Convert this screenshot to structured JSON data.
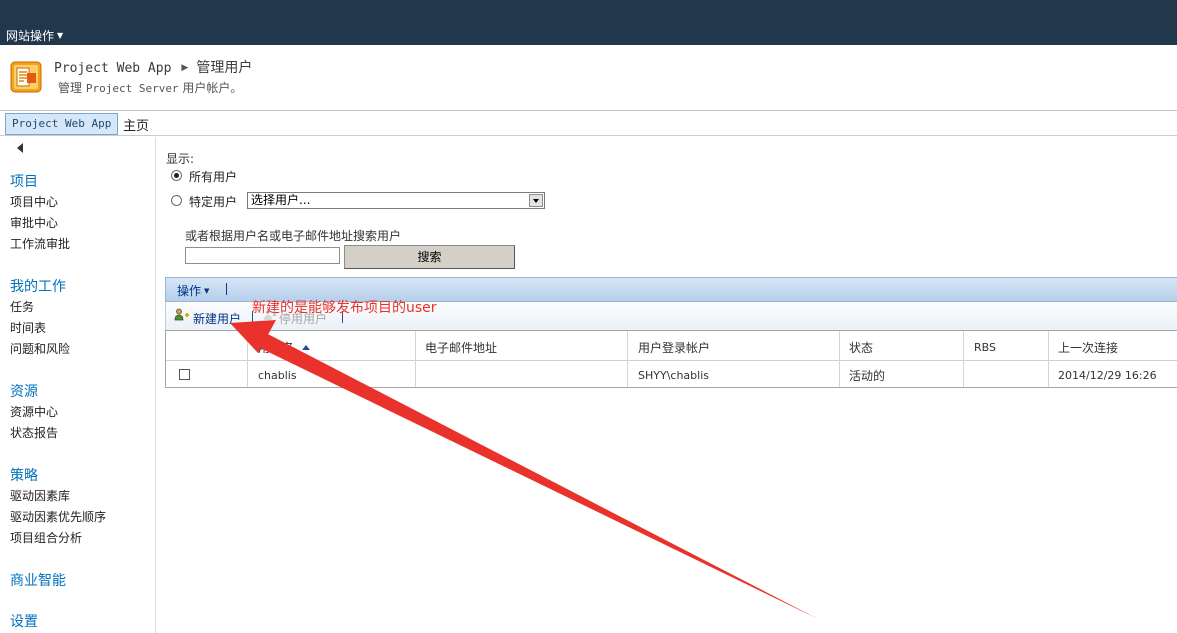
{
  "topbar": {
    "site_actions": "网站操作"
  },
  "title": {
    "app_link": "Project Web App",
    "current": "管理用户",
    "description_prefix": "管理",
    "description_mono": "Project Server",
    "description_suffix": "用户帐户。"
  },
  "topnav": {
    "active_tab": "Project Web App",
    "home": "主页"
  },
  "leftnav": {
    "groups": [
      {
        "heading": "项目",
        "items": [
          "项目中心",
          "审批中心",
          "工作流审批"
        ]
      },
      {
        "heading": "我的工作",
        "items": [
          "任务",
          "时间表",
          "问题和风险"
        ]
      },
      {
        "heading": "资源",
        "items": [
          "资源中心",
          "状态报告"
        ]
      },
      {
        "heading": "策略",
        "items": [
          "驱动因素库",
          "驱动因素优先顺序",
          "项目组合分析"
        ]
      },
      {
        "heading": "商业智能",
        "items": []
      },
      {
        "heading": "设置",
        "items": []
      }
    ]
  },
  "filter": {
    "show_label": "显示:",
    "all_users": "所有用户",
    "specific_users": "特定用户",
    "select_placeholder": "选择用户...",
    "search_hint": "或者根据用户名或电子邮件地址搜索用户",
    "search_button": "搜索"
  },
  "toolbar": {
    "actions_menu": "操作",
    "new_user": "新建用户",
    "disable_user": "停用用户"
  },
  "grid": {
    "headers": [
      "用户名",
      "电子邮件地址",
      "用户登录帐户",
      "状态",
      "RBS",
      "上一次连接"
    ],
    "rows": [
      {
        "name": "chablis",
        "email": "",
        "account": "SHYY\\chablis",
        "status": "活动的",
        "rbs": "",
        "last_connect": "2014/12/29 16:26"
      }
    ]
  },
  "annotation": {
    "text": "新建的是能够发布项目的user",
    "color": "#e8322b"
  },
  "colors": {
    "topbar": "#21374c",
    "nav_heading": "#0072bc",
    "link_blue": "#00338a"
  }
}
